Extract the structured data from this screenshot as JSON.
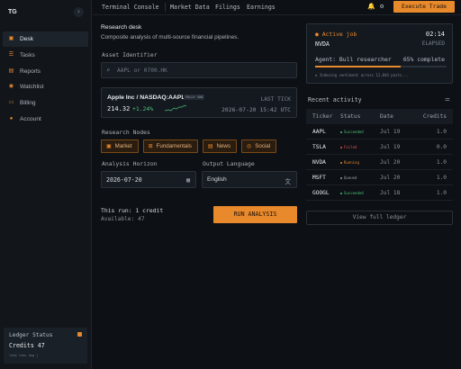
{
  "app": {
    "logo": "TG",
    "collapse_glyph": "‹"
  },
  "sidebar": {
    "items": [
      {
        "label": "Desk",
        "icon": "desk-icon",
        "glyph": "▣",
        "active": true
      },
      {
        "label": "Tasks",
        "icon": "tasks-icon",
        "glyph": "☰",
        "active": false
      },
      {
        "label": "Reports",
        "icon": "reports-icon",
        "glyph": "▤",
        "active": false
      },
      {
        "label": "Watchlist",
        "icon": "watchlist-icon",
        "glyph": "◉",
        "active": false
      },
      {
        "label": "Billing",
        "icon": "billing-icon",
        "glyph": "▭",
        "active": false
      },
      {
        "label": "Account",
        "icon": "account-icon",
        "glyph": "●",
        "active": false
      }
    ],
    "ledger": {
      "title": "Ledger Status",
      "credits": "Credits 47",
      "sub": "ledo ledo dag |"
    }
  },
  "topbar": {
    "tabs": [
      "Terminal Console",
      "Market Data",
      "Filings",
      "Earnings"
    ],
    "bell_glyph": "🔔",
    "gear_glyph": "⚙",
    "execute_label": "Execute Trade"
  },
  "desk": {
    "title": "Research desk",
    "subtitle": "Composite analysis of multi-source financial pipelines.",
    "asset_label": "Asset Identifier",
    "search_glyph": "⌕",
    "search_placeholder": "AAPL or 0700.HK",
    "ticker": {
      "name": "Apple Inc / NASDAQ:AAPL",
      "badge": "FULLY SUB",
      "price": "214.32",
      "change": "+1.24%",
      "last_tick_label": "LAST TICK",
      "last_tick_time": "2026-07-20 15:42 UTC"
    },
    "nodes_label": "Research Nodes",
    "nodes": [
      {
        "label": "Market",
        "glyph": "▣"
      },
      {
        "label": "Fundamentals",
        "glyph": "⊞"
      },
      {
        "label": "News",
        "glyph": "▤"
      },
      {
        "label": "Social",
        "glyph": "◎"
      }
    ],
    "horizon_label": "Analysis Horizon",
    "horizon_value": "2026-07-20",
    "calendar_glyph": "▦",
    "lang_label": "Output Language",
    "lang_value": "English",
    "translate_glyph": "文",
    "run_cost": "This run: 1 credit",
    "available": "Available: 47",
    "run_label": "RUN ANALYSIS"
  },
  "job": {
    "status": "● Active job",
    "ticker": "NVDA",
    "time": "02:14",
    "elapsed": "ELAPSED",
    "agent": "Agent: Bull researcher",
    "pct_label": "65% complete",
    "progress": 0.65,
    "log": "⇄ Indexing sentiment across 12,044 posts..."
  },
  "activity": {
    "title": "Recent activity",
    "filter_glyph": "⚌",
    "headers": [
      "Ticker",
      "Status",
      "Date",
      "Credits"
    ],
    "rows": [
      {
        "ticker": "AAPL",
        "status": "Succeeded",
        "color": "#4cc47a",
        "date": "Jul 19",
        "credits": "1.0"
      },
      {
        "ticker": "TSLA",
        "status": "Failed",
        "color": "#e05252",
        "date": "Jul 19",
        "credits": "0.0"
      },
      {
        "ticker": "NVDA",
        "status": "Running",
        "color": "#e8892b",
        "date": "Jul 20",
        "credits": "1.0"
      },
      {
        "ticker": "MSFT",
        "status": "Queued",
        "color": "#9aa2ac",
        "date": "Jul 20",
        "credits": "1.0"
      },
      {
        "ticker": "GOOGL",
        "status": "Succeeded",
        "color": "#4cc47a",
        "date": "Jul 18",
        "credits": "1.0"
      }
    ],
    "view_ledger": "View full ledger"
  }
}
